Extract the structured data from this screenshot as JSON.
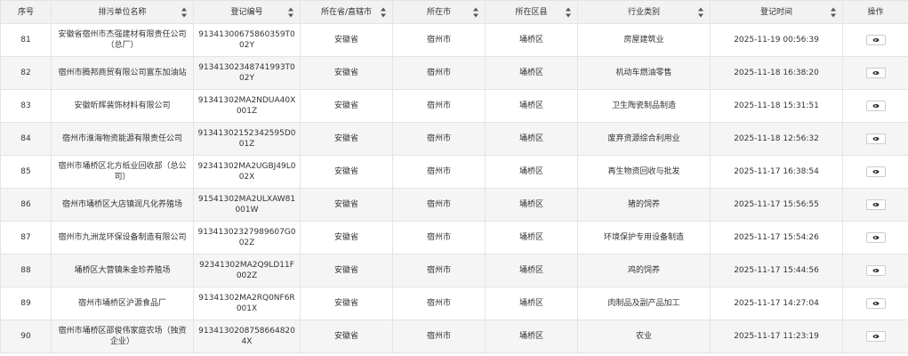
{
  "table": {
    "columns": [
      {
        "key": "seq",
        "label": "序号",
        "sortable": false
      },
      {
        "key": "name",
        "label": "排污单位名称",
        "sortable": true
      },
      {
        "key": "code",
        "label": "登记编号",
        "sortable": true
      },
      {
        "key": "province",
        "label": "所在省/直辖市",
        "sortable": true
      },
      {
        "key": "city",
        "label": "所在市",
        "sortable": true
      },
      {
        "key": "district",
        "label": "所在区县",
        "sortable": true
      },
      {
        "key": "industry",
        "label": "行业类别",
        "sortable": true
      },
      {
        "key": "time",
        "label": "登记时间",
        "sortable": true
      },
      {
        "key": "action",
        "label": "操作",
        "sortable": false
      }
    ],
    "rows": [
      {
        "seq": "81",
        "name": "安徽省宿州市杰强建材有限责任公司（总厂）",
        "code": "91341300675860359T002Y",
        "province": "安徽省",
        "city": "宿州市",
        "district": "埇桥区",
        "industry": "房屋建筑业",
        "time": "2025-11-19 00:56:39"
      },
      {
        "seq": "82",
        "name": "宿州市腾邦商贸有限公司富东加油站",
        "code": "91341302348741993T002Y",
        "province": "安徽省",
        "city": "宿州市",
        "district": "埇桥区",
        "industry": "机动车燃油零售",
        "time": "2025-11-18 16:38:20"
      },
      {
        "seq": "83",
        "name": "安徽昕辉装饰材料有限公司",
        "code": "91341302MA2NDUA40X001Z",
        "province": "安徽省",
        "city": "宿州市",
        "district": "埇桥区",
        "industry": "卫生陶瓷制品制造",
        "time": "2025-11-18 15:31:51"
      },
      {
        "seq": "84",
        "name": "宿州市淮海物资能源有限责任公司",
        "code": "91341302152342595D001Z",
        "province": "安徽省",
        "city": "宿州市",
        "district": "埇桥区",
        "industry": "废弃资源综合利用业",
        "time": "2025-11-18 12:56:32"
      },
      {
        "seq": "85",
        "name": "宿州市埇桥区北方纸业回收部（总公司）",
        "code": "92341302MA2UGBJ49L002X",
        "province": "安徽省",
        "city": "宿州市",
        "district": "埇桥区",
        "industry": "再生物资回收与批发",
        "time": "2025-11-17 16:38:54"
      },
      {
        "seq": "86",
        "name": "宿州市埇桥区大店镇润凡化养殖场",
        "code": "91541302MA2ULXAW81001W",
        "province": "安徽省",
        "city": "宿州市",
        "district": "埇桥区",
        "industry": "猪的饲养",
        "time": "2025-11-17 15:56:55"
      },
      {
        "seq": "87",
        "name": "宿州市九洲龙环保设备制造有限公司",
        "code": "91341302327989607G002Z",
        "province": "安徽省",
        "city": "宿州市",
        "district": "埇桥区",
        "industry": "环境保护专用设备制造",
        "time": "2025-11-17 15:54:26"
      },
      {
        "seq": "88",
        "name": "埇桥区大营镇朱金珍养殖场",
        "code": "92341302MA2Q9LD11F002Z",
        "province": "安徽省",
        "city": "宿州市",
        "district": "埇桥区",
        "industry": "鸡的饲养",
        "time": "2025-11-17 15:44:56"
      },
      {
        "seq": "89",
        "name": "宿州市埇桥区沪源食品厂",
        "code": "91341302MA2RQ0NF6R001X",
        "province": "安徽省",
        "city": "宿州市",
        "district": "埇桥区",
        "industry": "肉制品及副产品加工",
        "time": "2025-11-17 14:27:04"
      },
      {
        "seq": "90",
        "name": "宿州市埇桥区邵俊伟家庭农场（独资企业）",
        "code": "91341302087586648204X",
        "province": "安徽省",
        "city": "宿州市",
        "district": "埇桥区",
        "industry": "农业",
        "time": "2025-11-17 11:23:19"
      }
    ],
    "view_icon": "eye-icon"
  }
}
